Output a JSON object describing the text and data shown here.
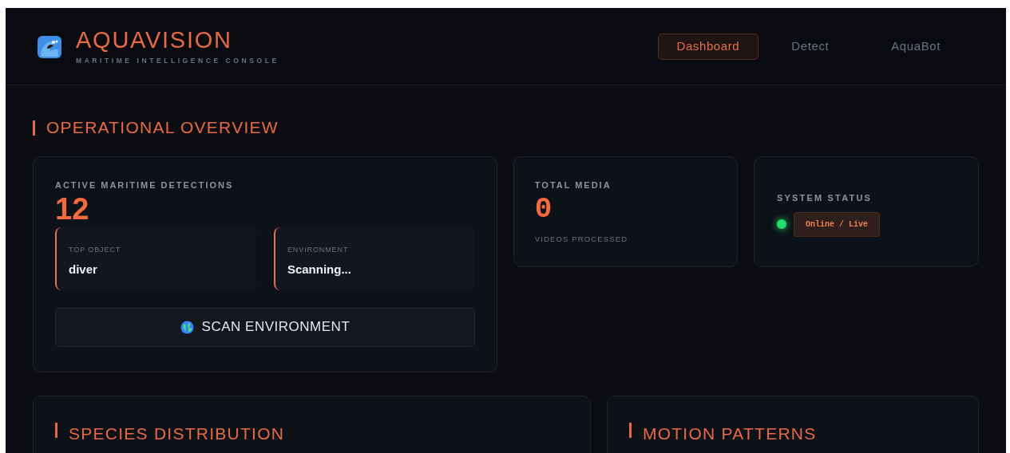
{
  "brand": {
    "title": "AQUAVISION",
    "subtitle": "MARITIME INTELLIGENCE CONSOLE"
  },
  "nav": [
    {
      "label": "Dashboard",
      "selected": true
    },
    {
      "label": "Detect",
      "selected": false
    },
    {
      "label": "AquaBot",
      "selected": false
    }
  ],
  "section_title": "OPERATIONAL OVERVIEW",
  "detections": {
    "label": "ACTIVE MARITIME DETECTIONS",
    "value": "12",
    "details": [
      {
        "label": "TOP OBJECT",
        "value": "diver"
      },
      {
        "label": "ENVIRONMENT",
        "value": "Scanning..."
      }
    ],
    "button": "SCAN ENVIRONMENT"
  },
  "media": {
    "label": "TOTAL MEDIA",
    "value": "0",
    "caption": "VIDEOS PROCESSED"
  },
  "system_status": {
    "label": "SYSTEM STATUS",
    "online": true,
    "badge": "Online / Live"
  },
  "panels": [
    "SPECIES DISTRIBUTION",
    "MOTION PATTERNS"
  ]
}
